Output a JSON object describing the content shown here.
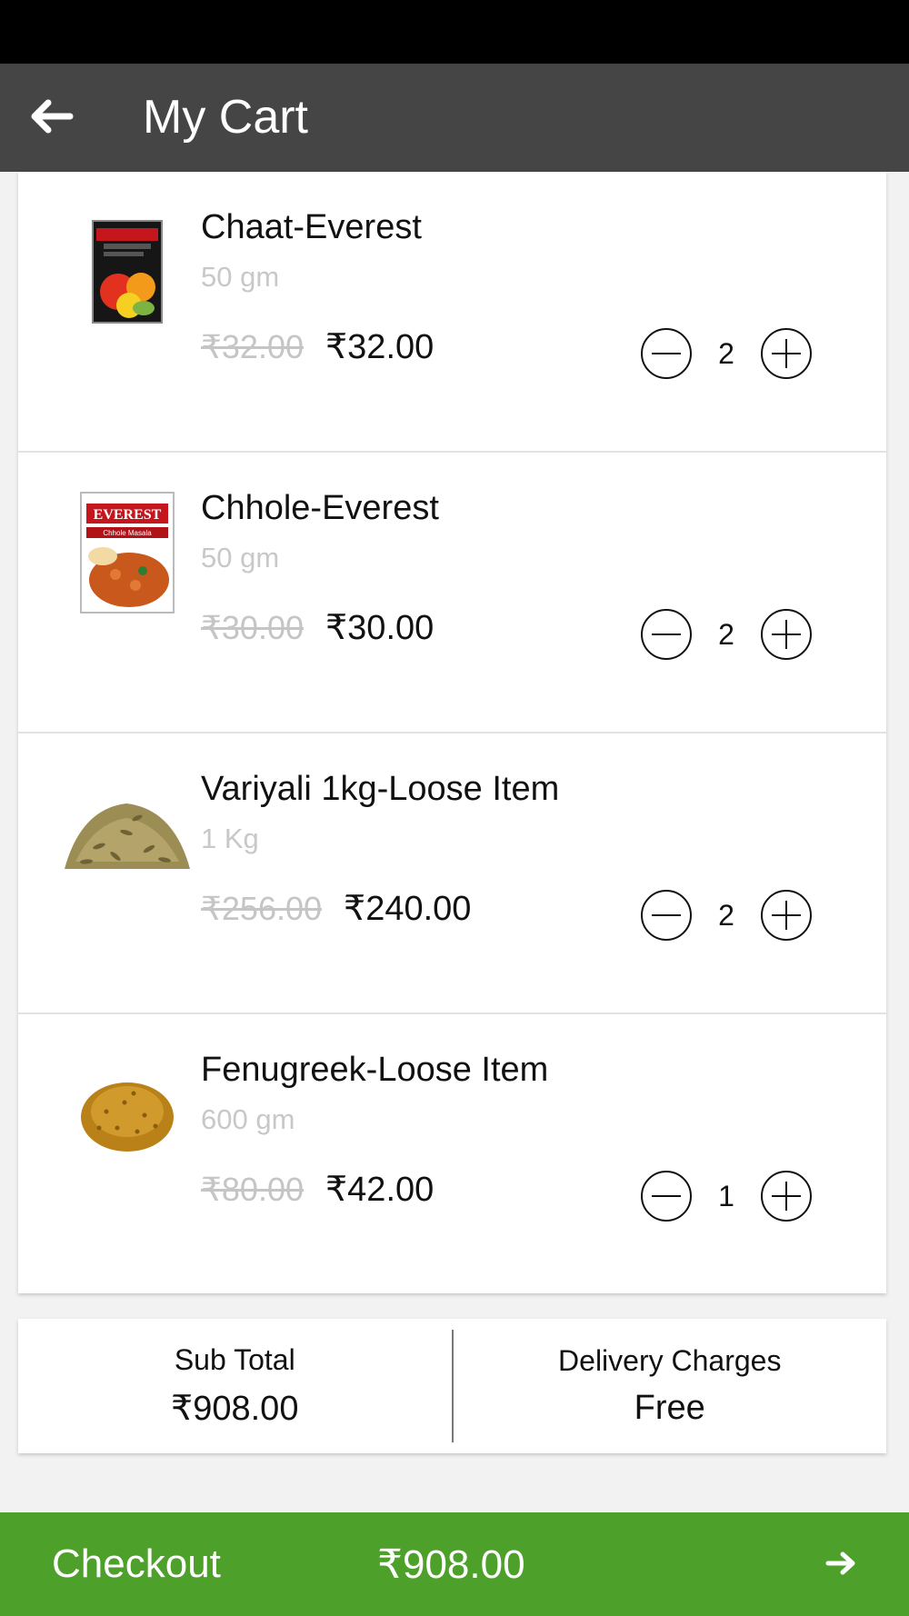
{
  "header": {
    "title": "My Cart",
    "back_icon": "arrow-left-icon"
  },
  "items": [
    {
      "name": "Chaat-Everest",
      "weight": "50 gm",
      "mrp": "₹32.00",
      "price": "₹32.00",
      "qty": "2",
      "image": "chaat-masala-box"
    },
    {
      "name": "Chhole-Everest",
      "weight": "50 gm",
      "mrp": "₹30.00",
      "price": "₹30.00",
      "qty": "2",
      "image": "chhole-masala-box",
      "image_text": [
        "EVEREST",
        "Chhole Masala"
      ]
    },
    {
      "name": "Variyali 1kg-Loose Item",
      "weight": "1 Kg",
      "mrp": "₹256.00",
      "price": "₹240.00",
      "qty": "2",
      "image": "fennel-seeds-pile"
    },
    {
      "name": "Fenugreek-Loose Item",
      "weight": "600 gm",
      "mrp": "₹80.00",
      "price": "₹42.00",
      "qty": "1",
      "image": "fenugreek-seeds-pile"
    }
  ],
  "summary": {
    "subtotal_label": "Sub Total",
    "subtotal_value": "₹908.00",
    "delivery_label": "Delivery Charges",
    "delivery_value": "Free"
  },
  "checkout": {
    "label": "Checkout",
    "total": "₹908.00",
    "arrow_icon": "arrow-right-icon"
  },
  "colors": {
    "app_bar": "#454545",
    "checkout": "#4da12a",
    "status_bar": "#000000"
  }
}
